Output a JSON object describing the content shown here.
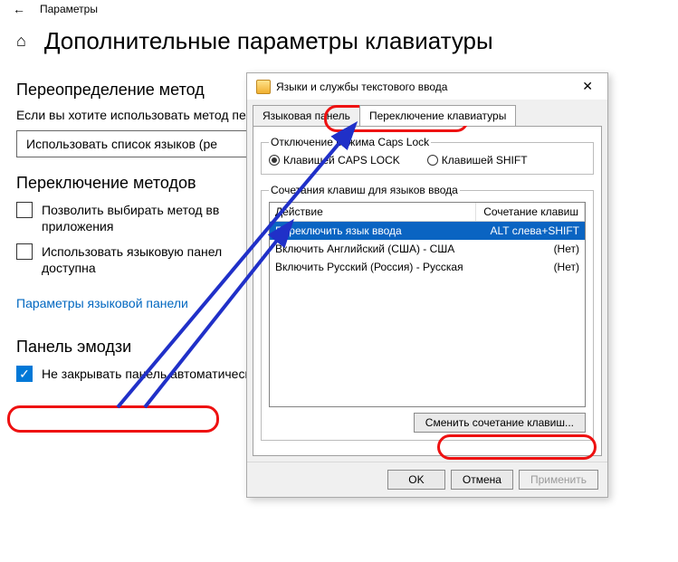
{
  "topbar": {
    "title": "Параметры"
  },
  "page": {
    "title": "Дополнительные параметры клавиатуры"
  },
  "section1": {
    "head": "Переопределение метод",
    "body": "Если вы хотите использовать метод первом месте в вашем списке язык",
    "dropdownValue": "Использовать список языков (ре"
  },
  "section2": {
    "head": "Переключение методов",
    "opt1": "Позволить выбирать метод вв приложения",
    "opt2": "Использовать языковую панел доступна",
    "linkText": "Параметры языковой панели"
  },
  "section3": {
    "head": "Панель эмодзи",
    "opt1": "Не закрывать панель автоматически после ввода эмодзи"
  },
  "dialog": {
    "title": "Языки и службы текстового ввода",
    "tabs": {
      "lang": "Языковая панель",
      "switch": "Переключение клавиатуры"
    },
    "capslock": {
      "legend": "Отключение режима Caps Lock",
      "opt1": "Клавишей CAPS LOCK",
      "opt2": "Клавишей SHIFT"
    },
    "hotkeys": {
      "legend": "Сочетания клавиш для языков ввода",
      "colAction": "Действие",
      "colKeys": "Сочетание клавиш",
      "rows": [
        {
          "action": "Переключить язык ввода",
          "keys": "ALT слева+SHIFT",
          "selected": true
        },
        {
          "action": "Включить Английский (США) - США",
          "keys": "(Нет)",
          "selected": false
        },
        {
          "action": "Включить Русский (Россия) - Русская",
          "keys": "(Нет)",
          "selected": false
        }
      ],
      "changeBtn": "Сменить сочетание клавиш..."
    },
    "footer": {
      "ok": "OK",
      "cancel": "Отмена",
      "apply": "Применить"
    }
  }
}
